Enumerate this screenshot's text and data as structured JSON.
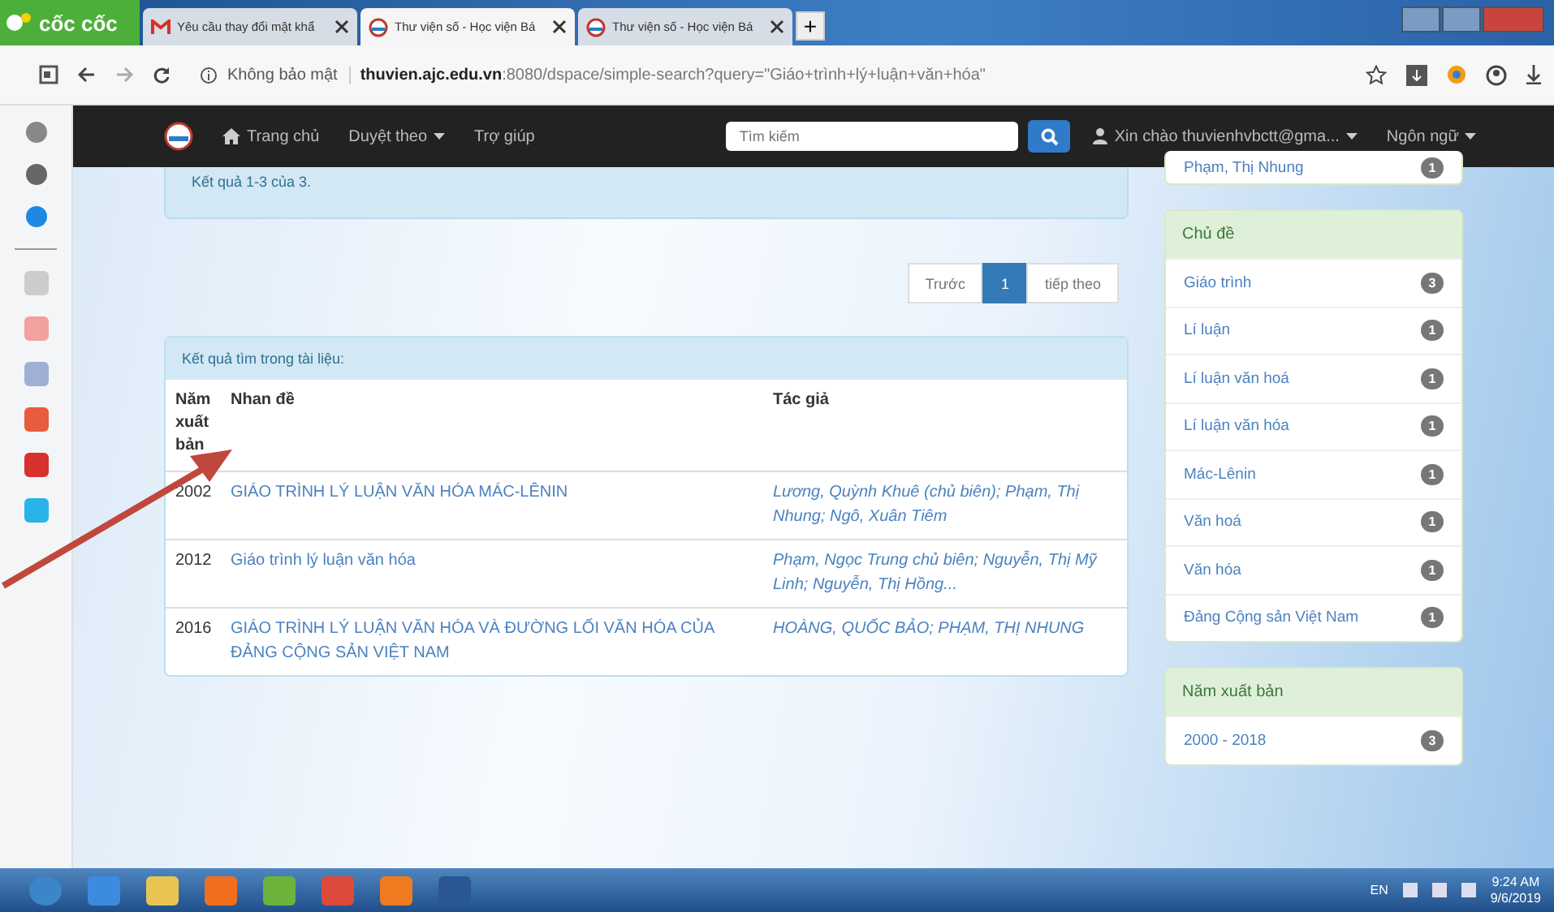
{
  "browser": {
    "brand": "cốc cốc",
    "tabs": [
      {
        "title": "Yêu cầu thay đổi mật khẩ",
        "kind": "mail",
        "selected": false
      },
      {
        "title": "Thư viện số - Học viện Bá",
        "kind": "site",
        "selected": true
      },
      {
        "title": "Thư viện số - Học viện Bá",
        "kind": "site",
        "selected": false
      }
    ],
    "new_tab": "+",
    "security": "Không bảo mật",
    "url_host": "thuvien.ajc.edu.vn",
    "url_rest": ":8080/dspace/simple-search?query=\"Giáo+trình+lý+luận+văn+hóa\""
  },
  "navbar": {
    "items": [
      {
        "label": "Trang chủ",
        "kind": "home"
      },
      {
        "label": "Duyệt theo",
        "kind": "dropdown"
      },
      {
        "label": "Trợ giúp",
        "kind": "link"
      }
    ],
    "search": {
      "placeholder": "Tìm kiếm"
    },
    "user": "Xin chào thuvienhvbctt@gma...",
    "language": "Ngôn ngữ"
  },
  "results_summary": "Kết quả 1-3 của 3.",
  "pagination": [
    {
      "label": "Trước",
      "selected": false
    },
    {
      "label": "1",
      "selected": true
    },
    {
      "label": "tiếp theo",
      "selected": false
    }
  ],
  "results": {
    "title": "Kết quả tìm trong tài liệu:",
    "columns": [
      "Năm xuất bản",
      "Nhan đề",
      "Tác giả"
    ],
    "rows": [
      {
        "year": "2002",
        "title": "GIÁO TRÌNH LÝ LUẬN VĂN HÓA MÁC-LÊNIN",
        "authors": "Lương, Quỳnh Khuê (chủ biên); Phạm, Thị Nhung; Ngô, Xuân Tiêm"
      },
      {
        "year": "2012",
        "title": "Giáo trình lý luận văn hóa",
        "authors": "Phạm, Ngọc Trung chủ biên; Nguyễn, Thị Mỹ Linh; Nguyễn, Thị Hồng..."
      },
      {
        "year": "2016",
        "title": "GIÁO TRÌNH LÝ LUẬN VĂN HÓA VÀ ĐƯỜNG LỐI VĂN HÓA CỦA ĐẢNG CỘNG SẢN VIỆT NAM",
        "authors": "HOÀNG, QUỐC BẢO; PHẠM, THỊ NHUNG"
      }
    ]
  },
  "facets": [
    {
      "items": [
        {
          "label": "Phạm, Thị Nhung",
          "count": "1"
        }
      ]
    },
    {
      "title": "Chủ đề",
      "items": [
        {
          "label": "Giáo trình",
          "count": "3"
        },
        {
          "label": "Lí luận",
          "count": "1"
        },
        {
          "label": "Lí luận văn hoá",
          "count": "1"
        },
        {
          "label": "Lí luận văn hóa",
          "count": "1"
        },
        {
          "label": "Mác-Lênin",
          "count": "1"
        },
        {
          "label": "Văn hoá",
          "count": "1"
        },
        {
          "label": "Văn hóa",
          "count": "1"
        },
        {
          "label": "Đảng Cộng sản Việt Nam",
          "count": "1"
        }
      ]
    },
    {
      "title": "Năm xuất bản",
      "items": [
        {
          "label": "2000 - 2018",
          "count": "3"
        }
      ]
    }
  ],
  "taskbar": {
    "language": "EN",
    "time": "9:24 AM",
    "date": "9/6/2019"
  }
}
